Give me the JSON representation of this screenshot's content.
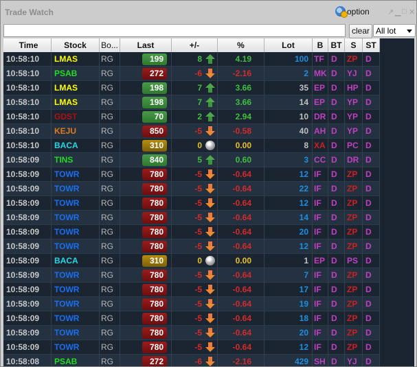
{
  "window": {
    "title": "Trade Watch",
    "option_label": "option",
    "controls": [
      "popout",
      "minimize",
      "maximize",
      "close"
    ]
  },
  "filter": {
    "value": "",
    "placeholder": "",
    "clear_label": "clear",
    "lot_select": {
      "selected": "All lot"
    }
  },
  "colors": {
    "up": "#3fbf3f",
    "down": "#d62a2a",
    "flat": "#e8c020",
    "lot_blue": "#1e8fe0",
    "lot_gray": "#c0c0c0",
    "broker_magenta": "#c040c0",
    "broker_red": "#cc2020",
    "stock_yellow": "#ffff00",
    "stock_green": "#22dd22",
    "stock_red": "#b01010",
    "stock_orange": "#e07a1a",
    "stock_cyan": "#22d8e8",
    "stock_blue": "#1a6ef0"
  },
  "columns": [
    "Time",
    "Stock",
    "Bo...",
    "Last",
    "+/-",
    "%",
    "Lot",
    "B",
    "BT",
    "S",
    "ST"
  ],
  "rows": [
    {
      "time": "10:58:10",
      "stock": "LMAS",
      "stock_color": "#ffff00",
      "board": "RG",
      "last": "199",
      "dir": "up",
      "chg": "8",
      "pct": "4.19",
      "lot": "100",
      "lot_color": "#1e8fe0",
      "b": "TF",
      "b_color": "#c040c0",
      "bt": "D",
      "s": "ZP",
      "s_color": "#cc2020",
      "st": "D"
    },
    {
      "time": "10:58:10",
      "stock": "PSAB",
      "stock_color": "#22dd22",
      "board": "RG",
      "last": "272",
      "dir": "down",
      "chg": "-6",
      "pct": "-2.16",
      "lot": "2",
      "lot_color": "#1e8fe0",
      "b": "MK",
      "b_color": "#c040c0",
      "bt": "D",
      "s": "YJ",
      "s_color": "#c040c0",
      "st": "D"
    },
    {
      "time": "10:58:10",
      "stock": "LMAS",
      "stock_color": "#ffff00",
      "board": "RG",
      "last": "198",
      "dir": "up",
      "chg": "7",
      "pct": "3.66",
      "lot": "35",
      "lot_color": "#c0c0c0",
      "b": "EP",
      "b_color": "#c040c0",
      "bt": "D",
      "s": "HP",
      "s_color": "#c040c0",
      "st": "D"
    },
    {
      "time": "10:58:10",
      "stock": "LMAS",
      "stock_color": "#ffff00",
      "board": "RG",
      "last": "198",
      "dir": "up",
      "chg": "7",
      "pct": "3.66",
      "lot": "14",
      "lot_color": "#c0c0c0",
      "b": "EP",
      "b_color": "#c040c0",
      "bt": "D",
      "s": "YP",
      "s_color": "#c040c0",
      "st": "D"
    },
    {
      "time": "10:58:10",
      "stock": "GDST",
      "stock_color": "#b01010",
      "board": "RG",
      "last": "70",
      "dir": "up",
      "chg": "2",
      "pct": "2.94",
      "lot": "10",
      "lot_color": "#c0c0c0",
      "b": "DR",
      "b_color": "#c040c0",
      "bt": "D",
      "s": "YP",
      "s_color": "#c040c0",
      "st": "D"
    },
    {
      "time": "10:58:10",
      "stock": "KEJU",
      "stock_color": "#e07a1a",
      "board": "RG",
      "last": "850",
      "dir": "down",
      "chg": "-5",
      "pct": "-0.58",
      "lot": "40",
      "lot_color": "#c0c0c0",
      "b": "AH",
      "b_color": "#c040c0",
      "bt": "D",
      "s": "YP",
      "s_color": "#c040c0",
      "st": "D"
    },
    {
      "time": "10:58:10",
      "stock": "BACA",
      "stock_color": "#22d8e8",
      "board": "RG",
      "last": "310",
      "dir": "flat",
      "chg": "0",
      "pct": "0.00",
      "lot": "8",
      "lot_color": "#c0c0c0",
      "b": "XA",
      "b_color": "#cc2020",
      "bt": "D",
      "s": "PC",
      "s_color": "#c040c0",
      "st": "D"
    },
    {
      "time": "10:58:09",
      "stock": "TINS",
      "stock_color": "#22dd22",
      "board": "RG",
      "last": "840",
      "dir": "up",
      "chg": "5",
      "pct": "0.60",
      "lot": "3",
      "lot_color": "#1e8fe0",
      "b": "CC",
      "b_color": "#c040c0",
      "bt": "D",
      "s": "DR",
      "s_color": "#c040c0",
      "st": "D"
    },
    {
      "time": "10:58:09",
      "stock": "TOWR",
      "stock_color": "#1a6ef0",
      "board": "RG",
      "last": "780",
      "dir": "down",
      "chg": "-5",
      "pct": "-0.64",
      "lot": "12",
      "lot_color": "#1e8fe0",
      "b": "IF",
      "b_color": "#c040c0",
      "bt": "D",
      "s": "ZP",
      "s_color": "#cc2020",
      "st": "D"
    },
    {
      "time": "10:58:09",
      "stock": "TOWR",
      "stock_color": "#1a6ef0",
      "board": "RG",
      "last": "780",
      "dir": "down",
      "chg": "-5",
      "pct": "-0.64",
      "lot": "22",
      "lot_color": "#1e8fe0",
      "b": "IF",
      "b_color": "#c040c0",
      "bt": "D",
      "s": "ZP",
      "s_color": "#cc2020",
      "st": "D"
    },
    {
      "time": "10:58:09",
      "stock": "TOWR",
      "stock_color": "#1a6ef0",
      "board": "RG",
      "last": "780",
      "dir": "down",
      "chg": "-5",
      "pct": "-0.64",
      "lot": "12",
      "lot_color": "#1e8fe0",
      "b": "IF",
      "b_color": "#c040c0",
      "bt": "D",
      "s": "ZP",
      "s_color": "#cc2020",
      "st": "D"
    },
    {
      "time": "10:58:09",
      "stock": "TOWR",
      "stock_color": "#1a6ef0",
      "board": "RG",
      "last": "780",
      "dir": "down",
      "chg": "-5",
      "pct": "-0.64",
      "lot": "14",
      "lot_color": "#1e8fe0",
      "b": "IF",
      "b_color": "#c040c0",
      "bt": "D",
      "s": "ZP",
      "s_color": "#cc2020",
      "st": "D"
    },
    {
      "time": "10:58:09",
      "stock": "TOWR",
      "stock_color": "#1a6ef0",
      "board": "RG",
      "last": "780",
      "dir": "down",
      "chg": "-5",
      "pct": "-0.64",
      "lot": "20",
      "lot_color": "#1e8fe0",
      "b": "IF",
      "b_color": "#c040c0",
      "bt": "D",
      "s": "ZP",
      "s_color": "#cc2020",
      "st": "D"
    },
    {
      "time": "10:58:09",
      "stock": "TOWR",
      "stock_color": "#1a6ef0",
      "board": "RG",
      "last": "780",
      "dir": "down",
      "chg": "-5",
      "pct": "-0.64",
      "lot": "12",
      "lot_color": "#1e8fe0",
      "b": "IF",
      "b_color": "#c040c0",
      "bt": "D",
      "s": "ZP",
      "s_color": "#cc2020",
      "st": "D"
    },
    {
      "time": "10:58:09",
      "stock": "BACA",
      "stock_color": "#22d8e8",
      "board": "RG",
      "last": "310",
      "dir": "flat",
      "chg": "0",
      "pct": "0.00",
      "lot": "1",
      "lot_color": "#c0c0c0",
      "b": "EP",
      "b_color": "#c040c0",
      "bt": "D",
      "s": "PS",
      "s_color": "#c040c0",
      "st": "D"
    },
    {
      "time": "10:58:09",
      "stock": "TOWR",
      "stock_color": "#1a6ef0",
      "board": "RG",
      "last": "780",
      "dir": "down",
      "chg": "-5",
      "pct": "-0.64",
      "lot": "7",
      "lot_color": "#1e8fe0",
      "b": "IF",
      "b_color": "#c040c0",
      "bt": "D",
      "s": "ZP",
      "s_color": "#cc2020",
      "st": "D"
    },
    {
      "time": "10:58:09",
      "stock": "TOWR",
      "stock_color": "#1a6ef0",
      "board": "RG",
      "last": "780",
      "dir": "down",
      "chg": "-5",
      "pct": "-0.64",
      "lot": "17",
      "lot_color": "#1e8fe0",
      "b": "IF",
      "b_color": "#c040c0",
      "bt": "D",
      "s": "ZP",
      "s_color": "#cc2020",
      "st": "D"
    },
    {
      "time": "10:58:09",
      "stock": "TOWR",
      "stock_color": "#1a6ef0",
      "board": "RG",
      "last": "780",
      "dir": "down",
      "chg": "-5",
      "pct": "-0.64",
      "lot": "19",
      "lot_color": "#1e8fe0",
      "b": "IF",
      "b_color": "#c040c0",
      "bt": "D",
      "s": "ZP",
      "s_color": "#cc2020",
      "st": "D"
    },
    {
      "time": "10:58:09",
      "stock": "TOWR",
      "stock_color": "#1a6ef0",
      "board": "RG",
      "last": "780",
      "dir": "down",
      "chg": "-5",
      "pct": "-0.64",
      "lot": "18",
      "lot_color": "#1e8fe0",
      "b": "IF",
      "b_color": "#c040c0",
      "bt": "D",
      "s": "ZP",
      "s_color": "#cc2020",
      "st": "D"
    },
    {
      "time": "10:58:09",
      "stock": "TOWR",
      "stock_color": "#1a6ef0",
      "board": "RG",
      "last": "780",
      "dir": "down",
      "chg": "-5",
      "pct": "-0.64",
      "lot": "20",
      "lot_color": "#1e8fe0",
      "b": "IF",
      "b_color": "#c040c0",
      "bt": "D",
      "s": "ZP",
      "s_color": "#cc2020",
      "st": "D"
    },
    {
      "time": "10:58:09",
      "stock": "TOWR",
      "stock_color": "#1a6ef0",
      "board": "RG",
      "last": "780",
      "dir": "down",
      "chg": "-5",
      "pct": "-0.64",
      "lot": "12",
      "lot_color": "#1e8fe0",
      "b": "IF",
      "b_color": "#c040c0",
      "bt": "D",
      "s": "ZP",
      "s_color": "#cc2020",
      "st": "D"
    },
    {
      "time": "10:58:08",
      "stock": "PSAB",
      "stock_color": "#22dd22",
      "board": "RG",
      "last": "272",
      "dir": "down",
      "chg": "-6",
      "pct": "-2.16",
      "lot": "429",
      "lot_color": "#1e8fe0",
      "b": "SH",
      "b_color": "#c040c0",
      "bt": "D",
      "s": "YJ",
      "s_color": "#c040c0",
      "st": "D"
    }
  ]
}
